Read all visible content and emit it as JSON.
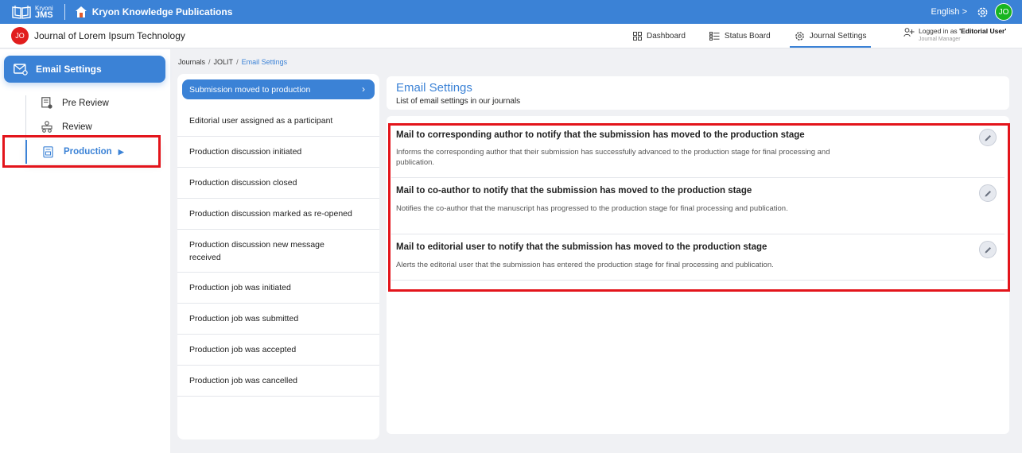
{
  "topbar": {
    "logo_small": "Kryoni",
    "logo_main": "JMS",
    "publisher": "Kryon Knowledge Publications",
    "language": "English >",
    "user_initials": "JO"
  },
  "subbar": {
    "journal_initials": "JO",
    "journal_name": "Journal of Lorem Ipsum Technology",
    "nav": [
      {
        "label": "Dashboard",
        "icon": "grid-icon"
      },
      {
        "label": "Status Board",
        "icon": "status-board-icon"
      },
      {
        "label": "Journal Settings",
        "icon": "gear-icon",
        "active": true
      }
    ],
    "login_prefix": "Logged in as",
    "login_role": "'Editorial User'",
    "login_sub": "Journal Manager"
  },
  "sidebar": {
    "header": "Email Settings",
    "items": [
      {
        "label": "Pre Review"
      },
      {
        "label": "Review"
      },
      {
        "label": "Production",
        "active": true
      }
    ]
  },
  "breadcrumb": {
    "items": [
      "Journals",
      "JOLIT",
      "Email Settings"
    ],
    "separator": "/"
  },
  "events": {
    "active": "Submission moved to production",
    "items": [
      "Editorial user assigned as a participant",
      "Production discussion initiated",
      "Production discussion closed",
      "Production discussion marked as re-opened",
      "Production discussion new message received",
      "Production job was initiated",
      "Production job was submitted",
      "Production job was accepted",
      "Production job was cancelled"
    ]
  },
  "panel": {
    "title": "Email Settings",
    "subtitle": "List of email settings in our journals",
    "mails": [
      {
        "title": "Mail to corresponding author to notify that the submission has moved to the production stage",
        "desc": "Informs the corresponding author that their submission has successfully advanced to the production stage for final processing and publication."
      },
      {
        "title": "Mail to co-author to notify that the submission has moved to the production stage",
        "desc": "Notifies the co-author that the manuscript has progressed to the production stage for final processing and publication."
      },
      {
        "title": "Mail to editorial user to notify that the submission has moved to the production stage",
        "desc": "Alerts the editorial user that the submission has entered the production stage for final processing and publication."
      }
    ]
  },
  "colors": {
    "primary": "#3b82d6",
    "highlight": "#e3141b",
    "avatar_green": "#18b520",
    "badge_red": "#e11d1d"
  }
}
